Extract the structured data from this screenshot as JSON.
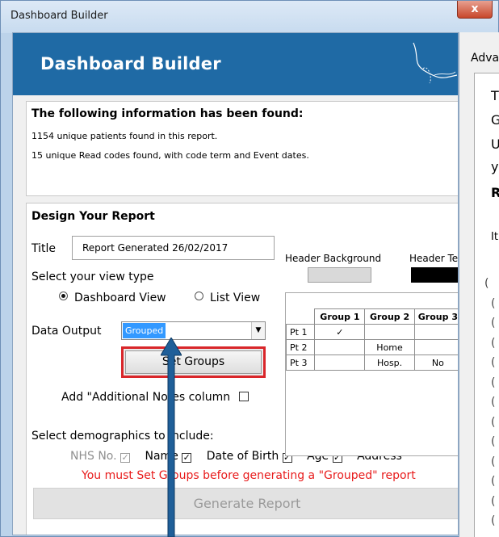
{
  "window": {
    "title": "Dashboard Builder",
    "close_label": "x"
  },
  "banner": {
    "title": "Dashboard Builder"
  },
  "info": {
    "heading": "The following information has been found:",
    "line1": "1154 unique patients found in this report.",
    "line2": "15 unique Read codes found, with code term and Event dates."
  },
  "design": {
    "heading": "Design Your Report",
    "title_label": "Title",
    "title_value": "Report Generated 26/02/2017",
    "view_label": "Select your view type",
    "view_options": [
      "Dashboard View",
      "List View"
    ],
    "data_output_label": "Data Output",
    "data_output_value": "Grouped",
    "set_groups_label": "Set Groups",
    "notes_label": "Add \"Additional Notes column",
    "demographics_label": "Select demographics to include:",
    "demographics": [
      "NHS No.",
      "Name",
      "Date of Birth",
      "Age",
      "Address"
    ],
    "warning": "You must Set Groups before generating a \"Grouped\" report",
    "generate_label": "Generate Report"
  },
  "colors": {
    "header_background_label": "Header Background",
    "header_text_label": "Header Text",
    "header_background": "#d9d9d9",
    "header_text": "#000000",
    "banner": "#1f6aa5",
    "warning": "#e81b1b"
  },
  "preview": {
    "headers": [
      "",
      "Group 1",
      "Group 2",
      "Group 3"
    ],
    "rows": [
      [
        "Pt 1",
        "✓",
        "",
        ""
      ],
      [
        "Pt 2",
        "",
        "Home",
        ""
      ],
      [
        "Pt 3",
        "",
        "Hosp.",
        "No"
      ]
    ]
  },
  "advanced": {
    "title": "Advanced",
    "lines": [
      "T",
      "G",
      "U",
      "y",
      "R",
      "It"
    ]
  }
}
